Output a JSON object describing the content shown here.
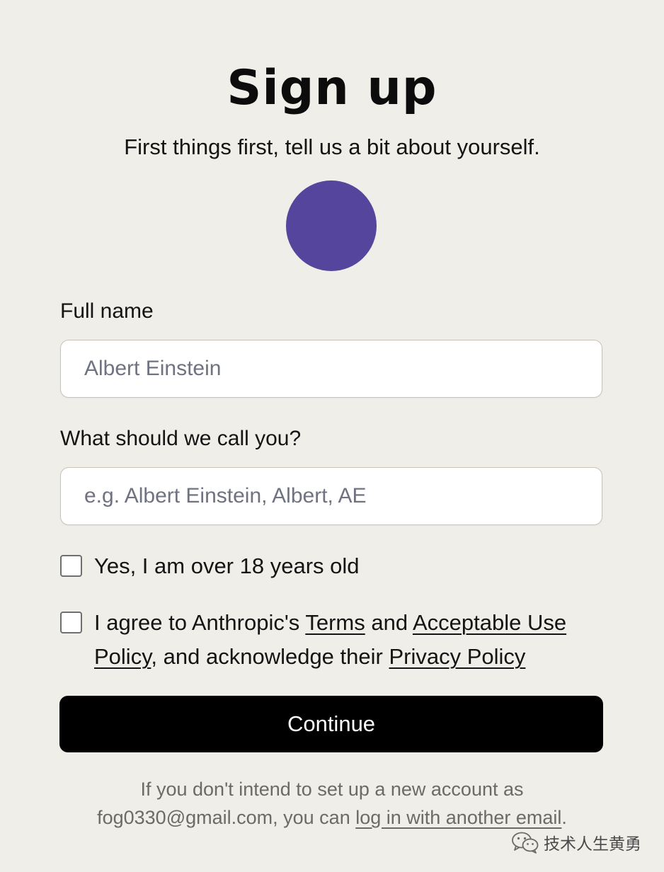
{
  "page": {
    "title": "Sign up",
    "subtitle": "First things first, tell us a bit about yourself.",
    "avatar_color": "#56459c"
  },
  "form": {
    "full_name": {
      "label": "Full name",
      "placeholder": "Albert Einstein",
      "value": ""
    },
    "nickname": {
      "label": "What should we call you?",
      "placeholder": "e.g. Albert Einstein, Albert, AE",
      "value": ""
    },
    "age_checkbox": {
      "checked": false,
      "label": "Yes, I am over 18 years old"
    },
    "terms_checkbox": {
      "checked": false,
      "text_1": "I agree to Anthropic's ",
      "terms_link": "Terms",
      "text_2": " and ",
      "aup_link": "Acceptable Use Policy",
      "text_3": ", and acknowledge their ",
      "privacy_link": "Privacy Policy"
    },
    "continue_label": "Continue"
  },
  "footer": {
    "text_1": "If you don't intend to set up a new account as",
    "email": "fog0330@gmail.com",
    "text_2": ", you can ",
    "link": "log in with another email",
    "text_3": "."
  },
  "watermark": {
    "icon": "wechat-icon",
    "text": "技术人生黄勇"
  }
}
